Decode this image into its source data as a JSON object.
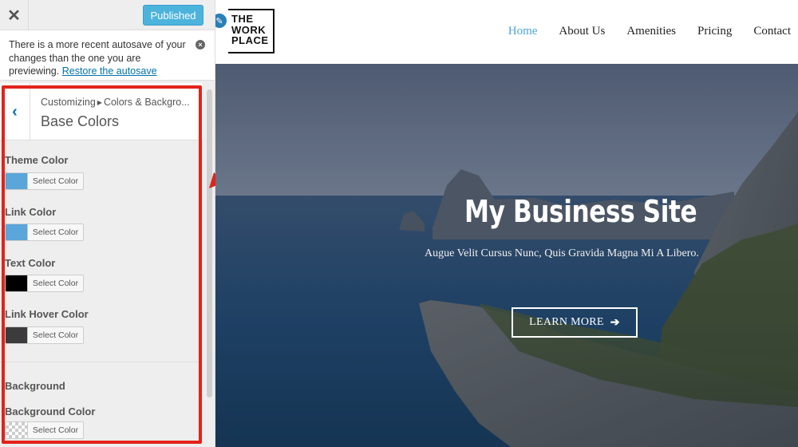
{
  "customizer": {
    "close_glyph": "✕",
    "publish_label": "Published",
    "notice": {
      "text": "There is a more recent autosave of your changes than the one you are previewing.",
      "link_text": "Restore the autosave",
      "dismiss_glyph": "×"
    },
    "panel": {
      "back_glyph": "‹",
      "breadcrumb_root": "Customizing",
      "breadcrumb_section": "Colors & Backgro...",
      "title": "Base Colors"
    },
    "controls": [
      {
        "label": "Theme Color",
        "button": "Select Color",
        "swatch": "#5aa5da"
      },
      {
        "label": "Link Color",
        "button": "Select Color",
        "swatch": "#5aa5da"
      },
      {
        "label": "Text Color",
        "button": "Select Color",
        "swatch": "#000000"
      },
      {
        "label": "Link Hover Color",
        "button": "Select Color",
        "swatch": "#3c3c3c"
      }
    ],
    "background_section": {
      "title": "Background",
      "control_label": "Background Color",
      "button": "Select Color",
      "swatch": "transparent"
    }
  },
  "site": {
    "logo": {
      "line1": "THE",
      "line2": "WORK",
      "line3": "PLACE"
    },
    "nav": [
      {
        "label": "Home",
        "active": true
      },
      {
        "label": "About Us",
        "active": false
      },
      {
        "label": "Amenities",
        "active": false
      },
      {
        "label": "Pricing",
        "active": false
      },
      {
        "label": "Contact",
        "active": false
      }
    ],
    "hero": {
      "title": "My Business Site",
      "subtitle": "Augue Velit Cursus Nunc, Quis Gravida Magna Mi A Libero.",
      "button_label": "LEARN MORE",
      "button_icon": "arrow-right-icon"
    }
  },
  "colors": {
    "accent": "#4cb3dd",
    "highlight": "#e2231a",
    "nav_active": "#4ba3d4",
    "link": "#0073aa"
  }
}
